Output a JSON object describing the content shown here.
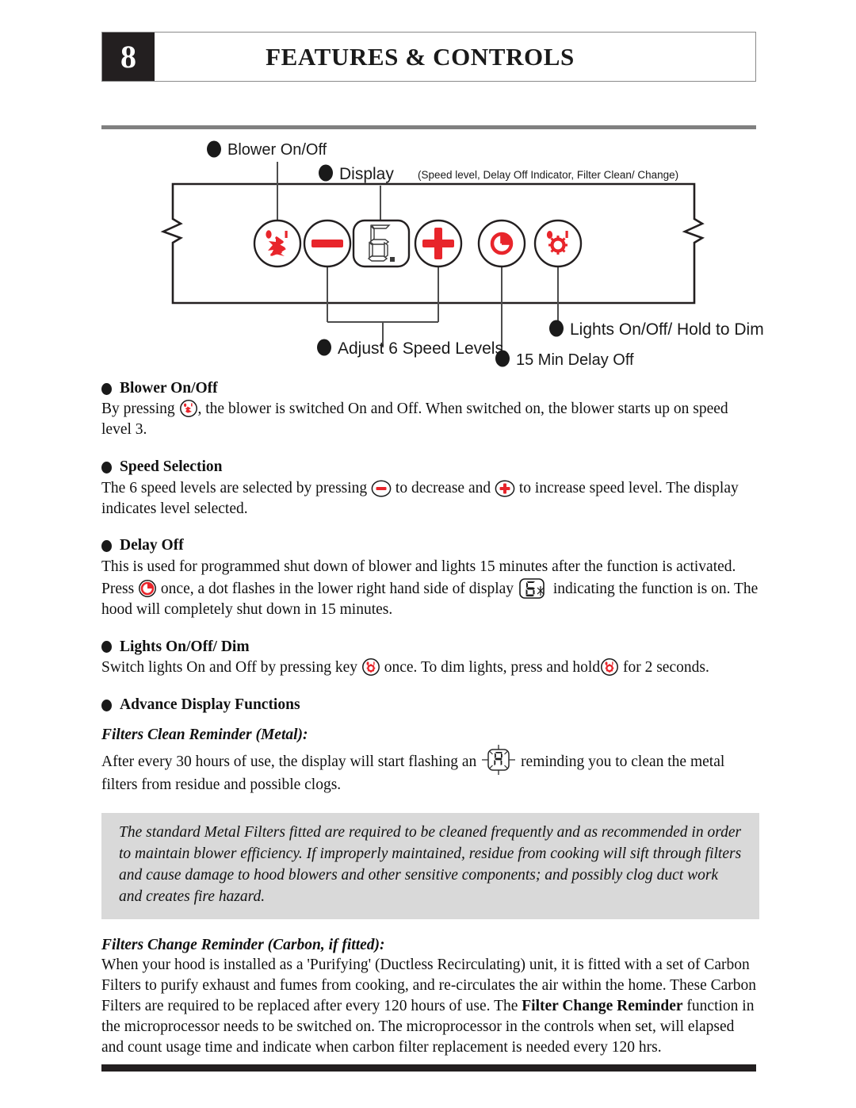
{
  "page": {
    "number": "8",
    "title": "FEATURES & CONTROLS"
  },
  "diagram": {
    "callouts": {
      "blower": "Blower On/Off",
      "display_label": "Display",
      "display_note": "(Speed level, Delay Off Indicator, Filter Clean/ Change)",
      "speed": "Adjust 6 Speed Levels",
      "delay": "15 Min Delay Off",
      "lights": "Lights On/Off/ Hold to Dim"
    },
    "buttons": [
      {
        "name": "blower-button",
        "icon": "fan-icon"
      },
      {
        "name": "minus-button",
        "icon": "minus-icon"
      },
      {
        "name": "display",
        "icon": "seven-segment-display",
        "value": "6."
      },
      {
        "name": "plus-button",
        "icon": "plus-icon"
      },
      {
        "name": "delay-button",
        "icon": "clock-icon"
      },
      {
        "name": "lights-button",
        "icon": "light-icon"
      }
    ],
    "colors": {
      "accent": "#e8252b",
      "outline": "#231f20"
    }
  },
  "sections": [
    {
      "heading": "Blower On/Off",
      "body_pre": "By pressing ",
      "body_post": ", the blower is switched On and Off.  When switched on, the blower starts up on speed level 3."
    },
    {
      "heading": "Speed Selection",
      "body_1": "The 6 speed levels are selected by pressing ",
      "body_2": " to decrease and ",
      "body_3": " to increase speed level.  The display indicates level selected."
    },
    {
      "heading": "Delay Off",
      "body_1": "This is used for programmed shut down of blower and lights 15 minutes after the function is activated.  Press ",
      "body_2": " once, a dot flashes in the lower right hand side of display ",
      "body_3": " indicating the function is on.  The hood will completely shut down in 15 minutes."
    },
    {
      "heading": "Lights On/Off/ Dim",
      "body_1": "Switch lights On and Off by pressing key ",
      "body_2": " once.  To dim lights, press and hold",
      "body_3": " for 2 seconds."
    },
    {
      "heading": "Advance Display Functions"
    }
  ],
  "filters_clean": {
    "subhead": "Filters Clean Reminder (Metal):",
    "body_1": "After every 30 hours of use, the display will start flashing an ",
    "body_2": " reminding you to clean the metal filters from residue and possible clogs."
  },
  "notice": {
    "text": "The standard Metal Filters fitted are required to be cleaned frequently and as recommended in order to maintain blower efficiency.  If  improperly maintained, residue from cooking will sift through filters and cause damage to hood blowers and other sensitive components; and possibly clog duct work and creates fire hazard.",
    "background": "#d9d9d9"
  },
  "filters_change": {
    "subhead": "Filters Change Reminder (Carbon, if fitted):",
    "body_1": "When your hood is installed as a 'Purifying' (Ductless Recirculating) unit, it is fitted with a set of Carbon Filters to purify exhaust and fumes from cooking, and re-circulates the air within the home. These Carbon Filters are required to be replaced after every 120 hours of use.  The ",
    "bold_1": "Filter Change Reminder",
    "body_2": " function in the microprocessor needs to be switched on.  The microprocessor in the controls when set, will elapsed and count usage time and indicate when carbon filter replacement is needed every 120 hrs."
  }
}
